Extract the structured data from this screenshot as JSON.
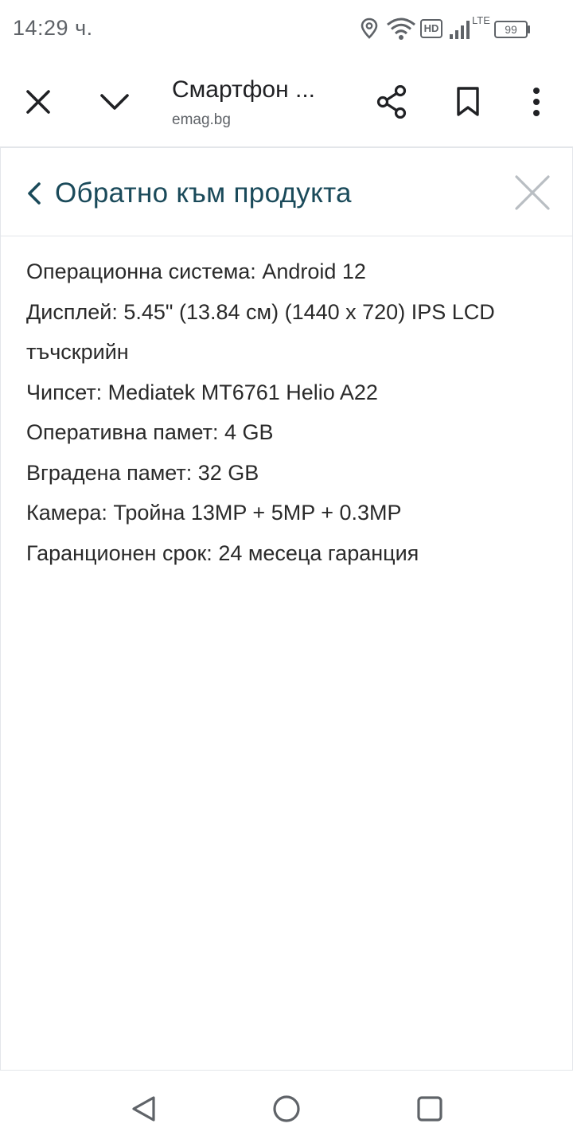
{
  "status_bar": {
    "time": "14:29 ч.",
    "network_badge": "HD",
    "network_type": "LTE",
    "battery_level": "99",
    "icons": [
      "location-icon",
      "wifi-icon",
      "hd-icon",
      "signal-icon",
      "battery-icon"
    ]
  },
  "toolbar": {
    "title": "Смартфон ...",
    "url": "emag.bg",
    "icons": [
      "close-icon",
      "chevron-down-icon",
      "share-icon",
      "bookmark-icon",
      "more-vertical-icon"
    ]
  },
  "panel": {
    "back_label": "Обратно към продукта",
    "close_icon": "close-icon"
  },
  "specs": [
    "Операционна система: Android 12",
    "Дисплей: 5.45\" (13.84 см) (1440 x 720) IPS LCD тъчскрийн",
    "Чипсет: Mediatek MT6761 Helio A22",
    "Оперативна памет: 4 GB",
    "Вградена памет: 32 GB",
    "Камера: Тройна 13MP + 5MP + 0.3MP",
    "Гаранционен срок: 24 месеца гаранция"
  ],
  "nav_bar": {
    "icons": [
      "back-triangle-icon",
      "home-circle-icon",
      "recents-square-icon"
    ]
  },
  "colors": {
    "back_link": "#1a4a5a",
    "text": "#2a2a2a",
    "icon": "#202124",
    "muted": "#5f6368",
    "divider": "#e3e6ea"
  }
}
